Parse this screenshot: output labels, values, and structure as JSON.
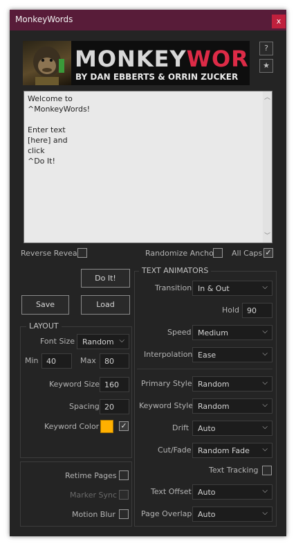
{
  "window": {
    "title": "MonkeyWords",
    "close_label": "x"
  },
  "banner": {
    "title_part1": "MONKEY",
    "title_part2": "WORDS",
    "byline": "BY DAN EBBERTS & ORRIN ZUCKER"
  },
  "header_buttons": {
    "help_label": "?",
    "star_label": "★"
  },
  "textarea": {
    "value": "Welcome to\n^MonkeyWords!\n\nEnter text\n[here] and\nclick\n^Do It!"
  },
  "options_row": {
    "reverse_reveal": "Reverse Reveal",
    "randomize_anchor": "Randomize Anchor",
    "all_caps": "All Caps",
    "all_caps_checked": true
  },
  "actions": {
    "do_it": "Do It!",
    "save": "Save",
    "load": "Load"
  },
  "layout": {
    "legend": "LAYOUT",
    "font_size_label": "Font Size",
    "font_size_value": "Random",
    "min_label": "Min",
    "min_value": "40",
    "max_label": "Max",
    "max_value": "80",
    "keyword_size_label": "Keyword Size",
    "keyword_size_value": "160",
    "spacing_label": "Spacing",
    "spacing_value": "20",
    "keyword_color_label": "Keyword Color",
    "keyword_color": "#ffb000"
  },
  "extras": {
    "retime_pages": "Retime Pages",
    "marker_sync": "Marker Sync",
    "motion_blur": "Motion Blur"
  },
  "text_animators": {
    "legend": "TEXT ANIMATORS",
    "transition_label": "Transition",
    "transition_value": "In & Out",
    "hold_label": "Hold",
    "hold_value": "90",
    "speed_label": "Speed",
    "speed_value": "Medium",
    "interpolation_label": "Interpolation",
    "interpolation_value": "Ease",
    "primary_style_label": "Primary Style",
    "primary_style_value": "Random",
    "keyword_style_label": "Keyword Style",
    "keyword_style_value": "Random",
    "drift_label": "Drift",
    "drift_value": "Auto",
    "cutfade_label": "Cut/Fade",
    "cutfade_value": "Random Fade",
    "text_tracking_label": "Text Tracking",
    "text_offset_label": "Text Offset",
    "text_offset_value": "Auto",
    "page_overlap_label": "Page Overlap",
    "page_overlap_value": "Auto"
  },
  "icons": {
    "chevron": "chevron-down-icon",
    "check": "check-icon"
  },
  "colors": {
    "titlebar": "#581c39",
    "close": "#c0203d",
    "accent_red": "#dd2b47",
    "panel": "#242424"
  }
}
